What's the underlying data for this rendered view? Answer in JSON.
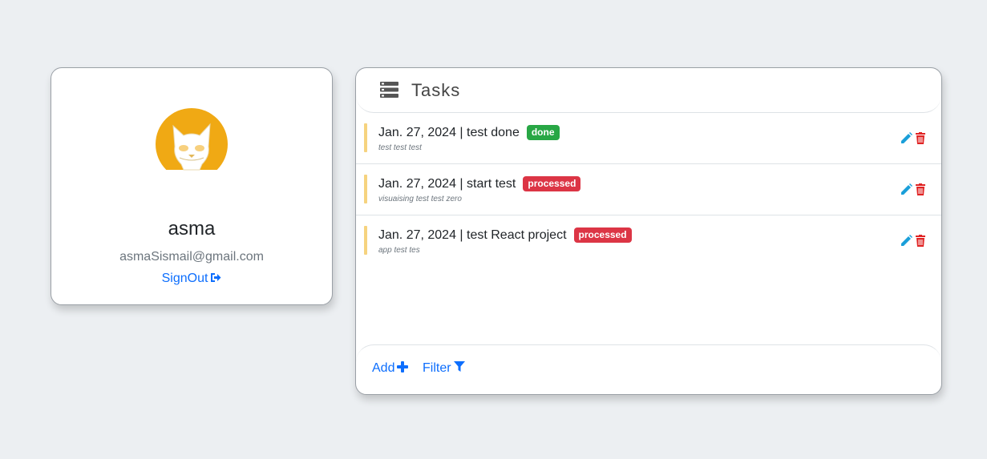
{
  "profile": {
    "name": "asma",
    "email": "asmaSismail@gmail.com",
    "signout_label": "SignOut",
    "avatar_icon": "cat-avatar-icon",
    "avatar_color": "#f0a914"
  },
  "tasks": {
    "title": "Tasks",
    "items": [
      {
        "title": "Jan. 27, 2024 | test done",
        "status": "done",
        "description": "test test test"
      },
      {
        "title": "Jan. 27, 2024 | start test",
        "status": "processed",
        "description": "visuaising test test zero"
      },
      {
        "title": "Jan. 27, 2024 | test React project",
        "status": "processed",
        "description": "app test tes"
      }
    ],
    "add_label": "Add",
    "filter_label": "Filter"
  },
  "colors": {
    "accent": "#0d6efd",
    "done": "#28a745",
    "processed": "#dc3545",
    "task_bar": "#f6d37f",
    "edit_icon": "#1a9fd9",
    "delete_icon": "#e02424"
  }
}
